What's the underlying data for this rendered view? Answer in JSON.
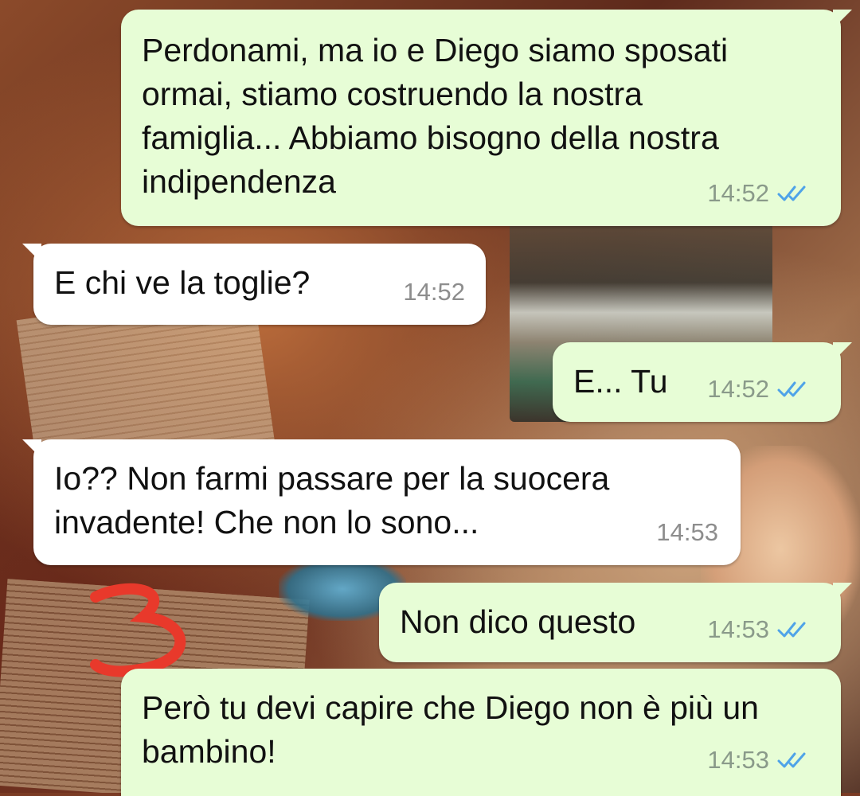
{
  "chat": {
    "messages": [
      {
        "direction": "outgoing",
        "text": "Perdonami, ma io e Diego siamo sposati ormai, stiamo costruendo la nostra famiglia... Abbiamo bisogno della nostra indipendenza",
        "time": "14:52",
        "status": "read"
      },
      {
        "direction": "incoming",
        "text": "E chi ve la toglie?",
        "time": "14:52"
      },
      {
        "direction": "outgoing",
        "text": "E... Tu",
        "time": "14:52",
        "status": "read"
      },
      {
        "direction": "incoming",
        "text": "Io?? Non farmi passare per la suocera invadente! Che non lo sono...",
        "time": "14:53"
      },
      {
        "direction": "outgoing",
        "text": "Non dico questo",
        "time": "14:53",
        "status": "read"
      },
      {
        "direction": "outgoing",
        "text": "Però tu devi capire che Diego non è più un bambino!",
        "time": "14:53",
        "status": "read"
      }
    ]
  },
  "colors": {
    "outgoing_bubble": "#e7fdd6",
    "incoming_bubble": "#ffffff",
    "read_tick": "#4fa3e8",
    "annotation": "#e8392b"
  },
  "icons": {
    "read_receipt": "double-check-icon"
  }
}
